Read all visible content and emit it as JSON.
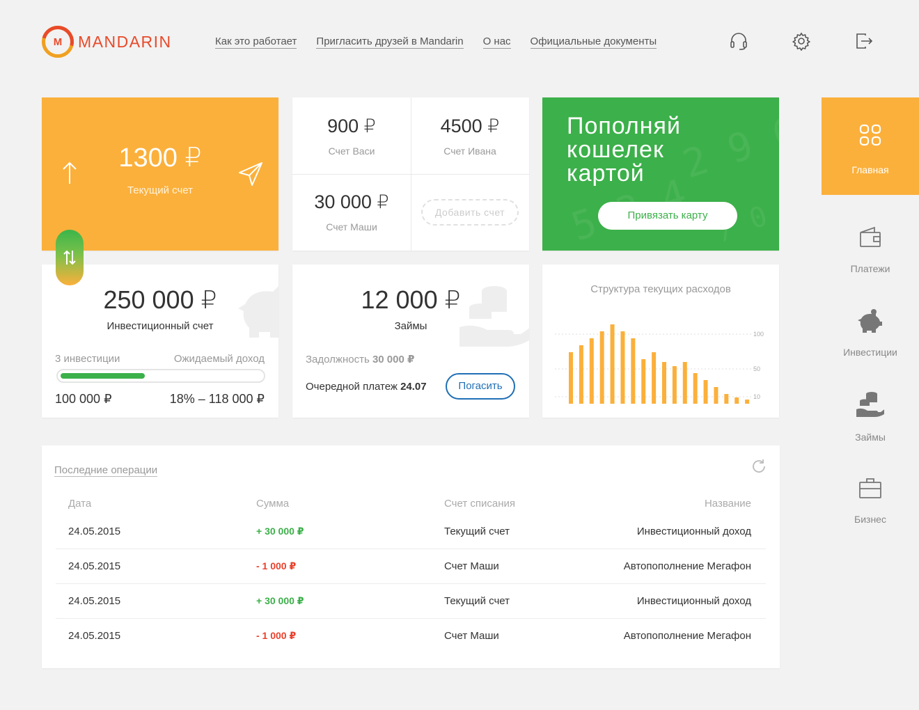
{
  "brand": {
    "mark": "M",
    "name": "MANDARIN"
  },
  "nav": [
    "Как это работает",
    "Пригласить друзей в Mandarin",
    "О нас",
    "Официальные документы"
  ],
  "header_icons": [
    "headset-icon",
    "gear-icon",
    "logout-icon"
  ],
  "current_account": {
    "amount": "1300 ₽",
    "label": "Текущий счет"
  },
  "sub_accounts": [
    {
      "amount": "900 ₽",
      "label": "Счет Васи"
    },
    {
      "amount": "4500 ₽",
      "label": "Счет Ивана"
    },
    {
      "amount": "30 000 ₽",
      "label": "Счет Маши"
    }
  ],
  "add_account_label": "Добавить счет",
  "promo": {
    "line1": "Пополняй",
    "line2": "кошелек",
    "line3": "картой",
    "button": "Привязать карту"
  },
  "investment": {
    "amount": "250 000 ₽",
    "label": "Инвестиционный счет",
    "count_label": "3 инвестиции",
    "expected_label": "Ожидаемый доход",
    "principal": "100 000 ₽",
    "expected_value": "18% – 118 000 ₽",
    "progress_fraction": 0.42
  },
  "loans": {
    "amount": "12 000 ₽",
    "label": "Займы",
    "debt_label": "Задолжность",
    "debt_value": "30 000 ₽",
    "next_label": "Очередной платеж",
    "next_date": "24.07",
    "pay_button": "Погасить"
  },
  "chart_data": {
    "type": "bar",
    "title": "Структура текущих расходов",
    "yticks": [
      "100",
      "50",
      "10"
    ],
    "ylim": [
      0,
      120
    ],
    "values": [
      74,
      84,
      94,
      104,
      114,
      104,
      94,
      64,
      74,
      60,
      54,
      60,
      44,
      34,
      24,
      14,
      9,
      6
    ]
  },
  "sidebar": [
    {
      "label": "Главная",
      "icon": "grid-icon",
      "active": true
    },
    {
      "label": "Платежи",
      "icon": "wallet-icon",
      "active": false
    },
    {
      "label": "Инвестиции",
      "icon": "piggy-bank-icon",
      "active": false
    },
    {
      "label": "Займы",
      "icon": "coins-hand-icon",
      "active": false
    },
    {
      "label": "Бизнес",
      "icon": "briefcase-icon",
      "active": false
    }
  ],
  "operations": {
    "title": "Последние операции",
    "columns": [
      "Дата",
      "Сумма",
      "Счет списания",
      "Название"
    ],
    "rows": [
      {
        "date": "24.05.2015",
        "sum": "+ 30 000 ₽",
        "account": "Текущий счет",
        "name": "Инвестиционный доход",
        "sign": "pos"
      },
      {
        "date": "24.05.2015",
        "sum": "- 1 000 ₽",
        "account": "Счет Маши",
        "name": "Автопополнение Мегафон",
        "sign": "neg"
      },
      {
        "date": "24.05.2015",
        "sum": "+ 30 000 ₽",
        "account": "Текущий счет",
        "name": "Инвестиционный доход",
        "sign": "pos"
      },
      {
        "date": "24.05.2015",
        "sum": "- 1 000 ₽",
        "account": "Счет Маши",
        "name": "Автопополнение Мегафон",
        "sign": "neg"
      }
    ]
  },
  "colors": {
    "orange": "#fbb03b",
    "green": "#3cb04a",
    "red": "#e8412c",
    "blue": "#1f6fb5",
    "brand": "#e84a2a"
  }
}
